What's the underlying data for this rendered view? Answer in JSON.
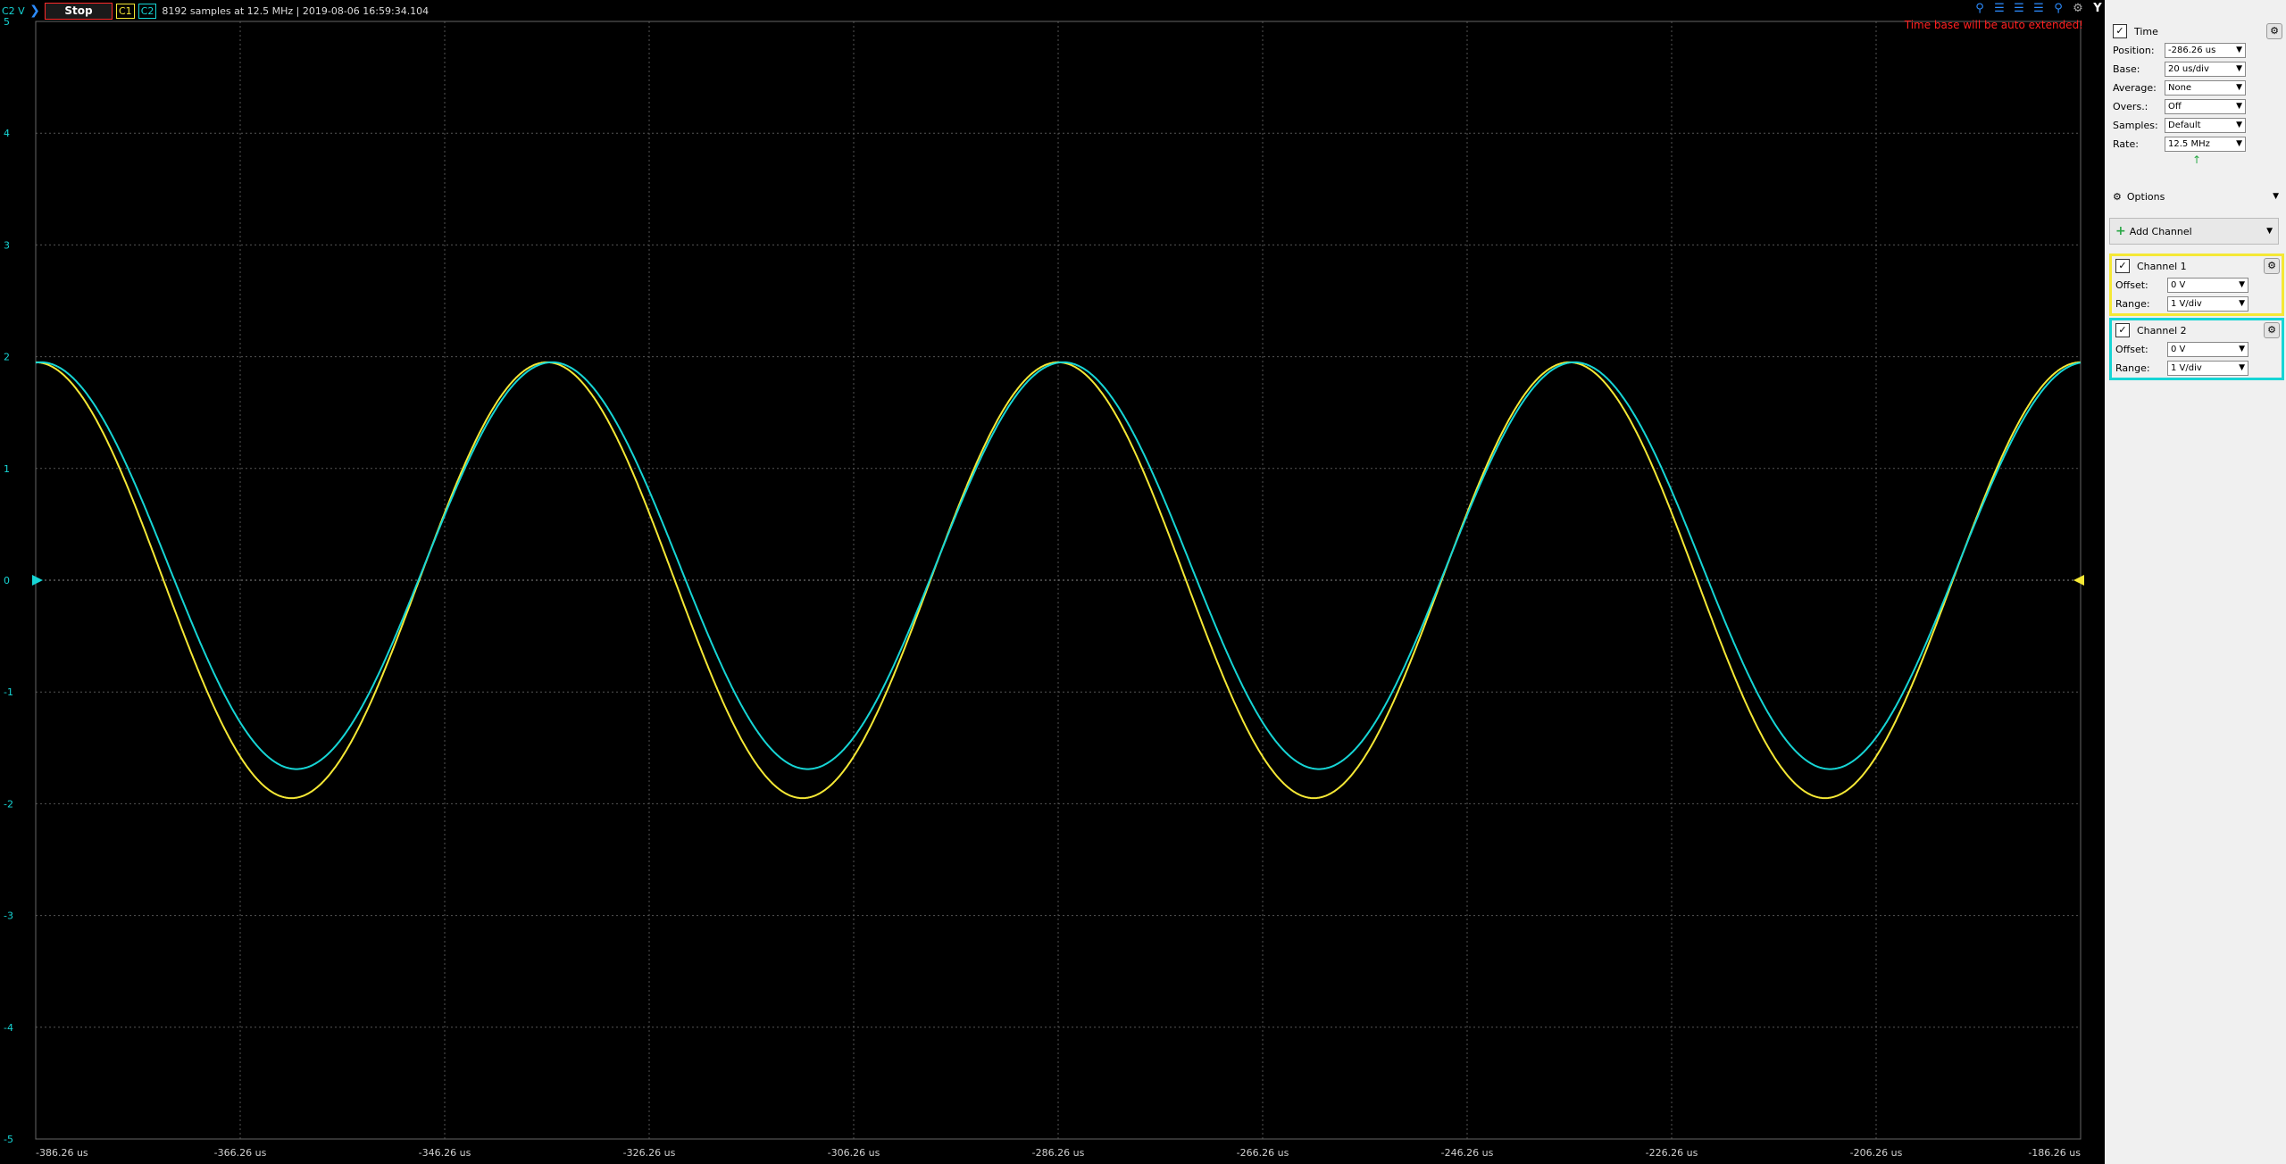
{
  "topbar": {
    "channel_indicator": "C2 V",
    "stop_label": "Stop",
    "c1_label": "C1",
    "c2_label": "C2",
    "status": "8192 samples at 12.5 MHz | 2019-08-06 16:59:34.104",
    "warning": "Time base will be auto extended!",
    "icons": [
      "zoom-icon",
      "align-left-icon",
      "align-center-icon",
      "align-right-icon",
      "zoom-in-icon",
      "settings-icon",
      "y-icon"
    ]
  },
  "panel": {
    "time": {
      "title": "Time",
      "rows": [
        {
          "label": "Position:",
          "value": "-286.26 us"
        },
        {
          "label": "Base:",
          "value": "20 us/div"
        },
        {
          "label": "Average:",
          "value": "None"
        },
        {
          "label": "Overs.:",
          "value": "Off"
        },
        {
          "label": "Samples:",
          "value": "Default"
        },
        {
          "label": "Rate:",
          "value": "12.5 MHz"
        }
      ]
    },
    "options_label": "Options",
    "add_channel_label": "Add Channel",
    "channel1": {
      "title": "Channel 1",
      "offset_label": "Offset:",
      "offset_value": "0 V",
      "range_label": "Range:",
      "range_value": "1 V/div"
    },
    "channel2": {
      "title": "Channel 2",
      "offset_label": "Offset:",
      "offset_value": "0 V",
      "range_label": "Range:",
      "range_value": "1 V/div"
    }
  },
  "colors": {
    "channel1": "#f5e835",
    "channel2": "#16d5d5",
    "stop_border": "#ff2a2a",
    "warning": "#ff2020"
  },
  "chart_data": {
    "type": "line",
    "x_ticks": [
      "-386.26 us",
      "-366.26 us",
      "-346.26 us",
      "-326.26 us",
      "-306.26 us",
      "-286.26 us",
      "-266.26 us",
      "-246.26 us",
      "-226.26 us",
      "-206.26 us",
      "-186.26 us"
    ],
    "y_ticks": [
      "5",
      "4",
      "3",
      "2",
      "1",
      "0",
      "-1",
      "-2",
      "-3",
      "-4",
      "-5"
    ],
    "xlim": [
      -386.26,
      -186.26
    ],
    "ylim": [
      -5,
      5
    ],
    "grid": true,
    "series": [
      {
        "channel": "C1",
        "color": "#f5e835",
        "amplitude": 1.95,
        "offset": 0.0,
        "period_us": 50,
        "peak_at_us": -336.26
      },
      {
        "channel": "C2",
        "color": "#16d5d5",
        "amplitude": 1.82,
        "offset": 0.13,
        "period_us": 50,
        "peak_at_us": -335.76
      }
    ]
  }
}
